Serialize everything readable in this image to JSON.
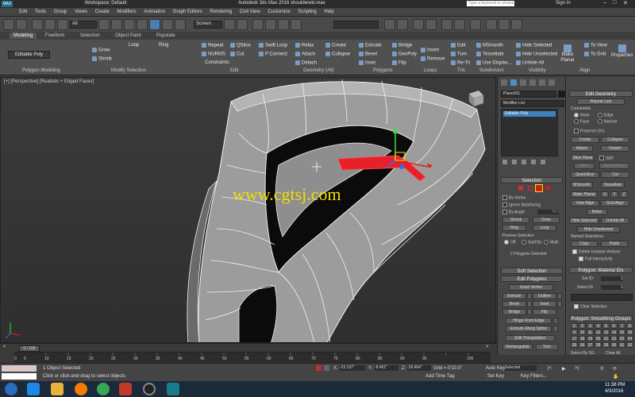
{
  "window": {
    "title": "Autodesk 3ds Max 2016    shouldereki.max",
    "workspace": "Workspace: Default",
    "search_placeholder": "Type a keyword or phrase",
    "sign_in": "Sign In"
  },
  "menu": [
    "Edit",
    "Tools",
    "Group",
    "Views",
    "Create",
    "Modifiers",
    "Animation",
    "Graph Editors",
    "Rendering",
    "Civil View",
    "Customize",
    "Scripting",
    "Help"
  ],
  "toolbar": {
    "selection_filter": "All",
    "ref_coord": "Screen"
  },
  "ribbon_tabs": [
    "Modeling",
    "Freeform",
    "Selection",
    "Object Paint",
    "Populate"
  ],
  "ribbon": {
    "groups": [
      "Polygon Modeling",
      "Modify Selection",
      "Edit",
      "Geometry (All)",
      "Polygons",
      "Loops",
      "Tris",
      "Subdivision",
      "Visibility",
      "Align",
      "Properties"
    ],
    "editable_poly": "Editable Poly",
    "grow": "Grow",
    "shrink": "Shrink",
    "loop": "Loop",
    "ring": "Ring",
    "repeat": "Repeat",
    "qslice": "QSlice",
    "swift_loop": "Swift Loop",
    "nurms": "NURMS",
    "cut": "Cut",
    "p_connect": "P Connect",
    "constraints": "Constraints:",
    "relax": "Relax",
    "create": "Create",
    "attach": "Attach",
    "collapse": "Collapse",
    "detach": "Detach",
    "extrude": "Extrude",
    "bridge": "Bridge",
    "bevel": "Bevel",
    "geopoly": "GeoPoly",
    "inset": "Inset",
    "flip": "Flip",
    "insert": "Insert",
    "remove": "Remove",
    "edit": "Edit",
    "turn": "Turn",
    "retri": "Re-Tri",
    "msmooth": "MSmooth",
    "tessellate": "Tessellate",
    "use_displace": "Use Displac...",
    "hide_selected": "Hide Selected",
    "hide_unselected": "Hide Unselected",
    "unhide_all": "Unhide All",
    "make_planar": "Make Planar",
    "to_view": "To View",
    "to_grid": "To Grid",
    "properties": "Properties"
  },
  "viewport": {
    "label": "[+] [Perspective] [Realistic + Edged Faces]",
    "watermark": "www.cgtsj.com"
  },
  "command_panel": {
    "object_name": "Plane001",
    "modifier_list": "Modifier List",
    "stack_item": "Editable Poly",
    "selection_head": "Selection",
    "by_vertex": "By Vertex",
    "ignore_backfacing": "Ignore Backfacing",
    "by_angle": "By Angle:",
    "angle_value": "45.0",
    "shrink": "Shrink",
    "grow": "Grow",
    "ring": "Ring",
    "loop": "Loop",
    "preview_selection": "Preview Selection",
    "off": "Off",
    "subobj": "SubObj",
    "multi": "Multi",
    "selected_count": "2 Polygons Selected",
    "soft_selection": "Soft Selection",
    "edit_polygons": "Edit Polygons",
    "insert_vertex": "Insert Vertex",
    "extrude": "Extrude",
    "outline": "Outline",
    "bevel": "Bevel",
    "inset": "Inset",
    "bridge": "Bridge",
    "flip": "Flip",
    "hinge_from_edge": "Hinge From Edge",
    "extrude_along_spline": "Extrude Along Spline",
    "edit_triangulation": "Edit Triangulation",
    "retriangulate": "Retriangulate",
    "turn": "Turn"
  },
  "right_panel": {
    "edit_geometry": "Edit Geometry",
    "repeat_last": "Repeat Last",
    "constraints": "Constraints",
    "none": "None",
    "edge": "Edge",
    "face": "Face",
    "normal": "Normal",
    "preserve_uvs": "Preserve UVs",
    "create": "Create",
    "collapse": "Collapse",
    "attach": "Attach",
    "detach": "Detach",
    "slice_plane": "Slice Plane",
    "split": "Split",
    "slice": "Slice",
    "reset_plane": "Reset Plane",
    "quickslice": "QuickSlice",
    "cut": "Cut",
    "msmooth": "MSmooth",
    "tessellate": "Tessellate",
    "make_planar": "Make Planar",
    "x": "X",
    "y": "Y",
    "z": "Z",
    "view_align": "View Align",
    "grid_align": "Grid Align",
    "relax": "Relax",
    "hide_selected": "Hide Selected",
    "unhide_all": "Unhide All",
    "hide_unselected": "Hide Unselected",
    "named_selections": "Named Selections:",
    "copy": "Copy",
    "paste": "Paste",
    "delete_isolated": "Delete Isolated Vertices",
    "full_interactivity": "Full Interactivity",
    "material_ids": "Polygon: Material IDs",
    "set_id": "Set ID:",
    "set_id_val": "1",
    "select_id": "Select ID",
    "select_id_val": "1",
    "clear_selection": "Clear Selection",
    "smoothing_groups": "Polygon: Smoothing Groups",
    "sg_numbers": [
      "1",
      "2",
      "3",
      "4",
      "5",
      "6",
      "7",
      "8",
      "9",
      "10",
      "11",
      "12",
      "13",
      "14",
      "15",
      "16",
      "17",
      "18",
      "19",
      "20",
      "21",
      "22",
      "23",
      "24",
      "25",
      "26",
      "27",
      "28",
      "29",
      "30",
      "31",
      "32"
    ],
    "select_by_sg": "Select By SG",
    "clear_all": "Clear All"
  },
  "timeline": {
    "frame": "0 / 100",
    "ticks": [
      "0",
      "5",
      "10",
      "15",
      "20",
      "25",
      "30",
      "35",
      "40",
      "45",
      "50",
      "55",
      "60",
      "65",
      "70",
      "75",
      "80",
      "85",
      "90",
      "95",
      "100"
    ]
  },
  "status": {
    "selected": "1 Object Selected",
    "prompt": "Click or click-and-drag to select objects",
    "x": "-23.197\"",
    "y": "-8.461\"",
    "z": "-28.464\"",
    "grid": "Grid = 0'10.0\"",
    "add_time_tag": "Add Time Tag",
    "auto_key": "Auto Key",
    "selected_mode": "Selected",
    "set_key": "Set Key",
    "key_filters": "Key Filters..."
  },
  "taskbar": {
    "time": "11:38 PM",
    "date": "4/3/2016"
  },
  "colors": {
    "selection_red": "#e8202a",
    "watermark_yellow": "#f0e000",
    "mesh_grey": "#9e9e9e",
    "hole_black": "#0a0a0a",
    "panel": "#474747",
    "taskbar": "#1b2a3a"
  }
}
